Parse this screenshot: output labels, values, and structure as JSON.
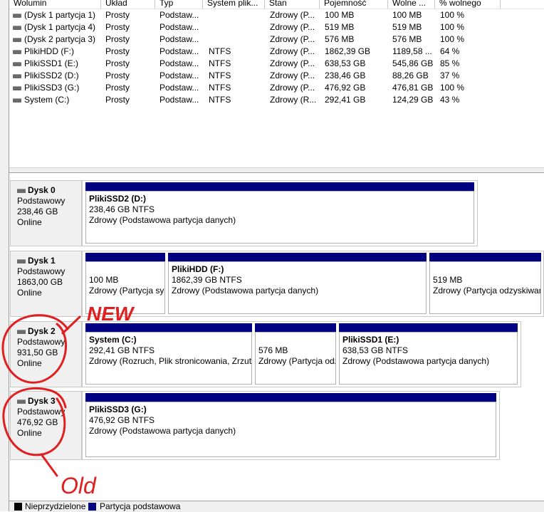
{
  "volume_list": {
    "columns": [
      "Wolumin",
      "Układ",
      "Typ",
      "System plik...",
      "Stan",
      "Pojemność",
      "Wolne ...",
      "% wolnego"
    ],
    "rows": [
      [
        "(Dysk 1 partycja 1)",
        "Prosty",
        "Podstaw...",
        "",
        "Zdrowy (P...",
        "100 MB",
        "100 MB",
        "100 %"
      ],
      [
        "(Dysk 1 partycja 4)",
        "Prosty",
        "Podstaw...",
        "",
        "Zdrowy (P...",
        "519 MB",
        "519 MB",
        "100 %"
      ],
      [
        "(Dysk 2 partycja 3)",
        "Prosty",
        "Podstaw...",
        "",
        "Zdrowy (P...",
        "576 MB",
        "576 MB",
        "100 %"
      ],
      [
        "PlikiHDD (F:)",
        "Prosty",
        "Podstaw...",
        "NTFS",
        "Zdrowy (P...",
        "1862,39 GB",
        "1189,58 ...",
        "64 %"
      ],
      [
        "PlikiSSD1 (E:)",
        "Prosty",
        "Podstaw...",
        "NTFS",
        "Zdrowy (P...",
        "638,53 GB",
        "545,86 GB",
        "85 %"
      ],
      [
        "PlikiSSD2 (D:)",
        "Prosty",
        "Podstaw...",
        "NTFS",
        "Zdrowy (P...",
        "238,46 GB",
        "88,26 GB",
        "37 %"
      ],
      [
        "PlikiSSD3 (G:)",
        "Prosty",
        "Podstaw...",
        "NTFS",
        "Zdrowy (P...",
        "476,92 GB",
        "476,81 GB",
        "100 %"
      ],
      [
        "System (C:)",
        "Prosty",
        "Podstaw...",
        "NTFS",
        "Zdrowy (R...",
        "292,41 GB",
        "124,29 GB",
        "43 %"
      ]
    ]
  },
  "disks": [
    {
      "name": "Dysk 0",
      "type": "Podstawowy",
      "size": "238,46 GB",
      "status": "Online",
      "partitions": [
        {
          "title": "PlikiSSD2  (D:)",
          "size": "238,46 GB NTFS",
          "status": "Zdrowy (Podstawowa partycja danych)"
        }
      ]
    },
    {
      "name": "Dysk 1",
      "type": "Podstawowy",
      "size": "1863,00 GB",
      "status": "Online",
      "partitions": [
        {
          "title": "",
          "size": "100 MB",
          "status": "Zdrowy (Partycja systemu EFI)"
        },
        {
          "title": "PlikiHDD  (F:)",
          "size": "1862,39 GB NTFS",
          "status": "Zdrowy (Podstawowa partycja danych)"
        },
        {
          "title": "",
          "size": "519 MB",
          "status": "Zdrowy (Partycja odzyskiwania)"
        }
      ]
    },
    {
      "name": "Dysk 2",
      "type": "Podstawowy",
      "size": "931,50 GB",
      "status": "Online",
      "partitions": [
        {
          "title": "System  (C:)",
          "size": "292,41 GB NTFS",
          "status": "Zdrowy (Rozruch, Plik stronicowania, Zrzut awaryjny)"
        },
        {
          "title": "",
          "size": "576 MB",
          "status": "Zdrowy (Partycja odzyskiwania)"
        },
        {
          "title": "PlikiSSD1  (E:)",
          "size": "638,53 GB NTFS",
          "status": "Zdrowy (Podstawowa partycja danych)"
        }
      ]
    },
    {
      "name": "Dysk 3",
      "type": "Podstawowy",
      "size": "476,92 GB",
      "status": "Online",
      "partitions": [
        {
          "title": "PlikiSSD3  (G:)",
          "size": "476,92 GB NTFS",
          "status": "Zdrowy (Podstawowa partycja danych)"
        }
      ]
    }
  ],
  "legend": {
    "unallocated": "Nieprzydzielone",
    "primary": "Partycja podstawowa"
  },
  "annotations": {
    "new": "NEW",
    "old": "Old"
  },
  "colors": {
    "primary_partition": "#000080",
    "unallocated": "#000000",
    "annotation_ink": "#e02020"
  }
}
